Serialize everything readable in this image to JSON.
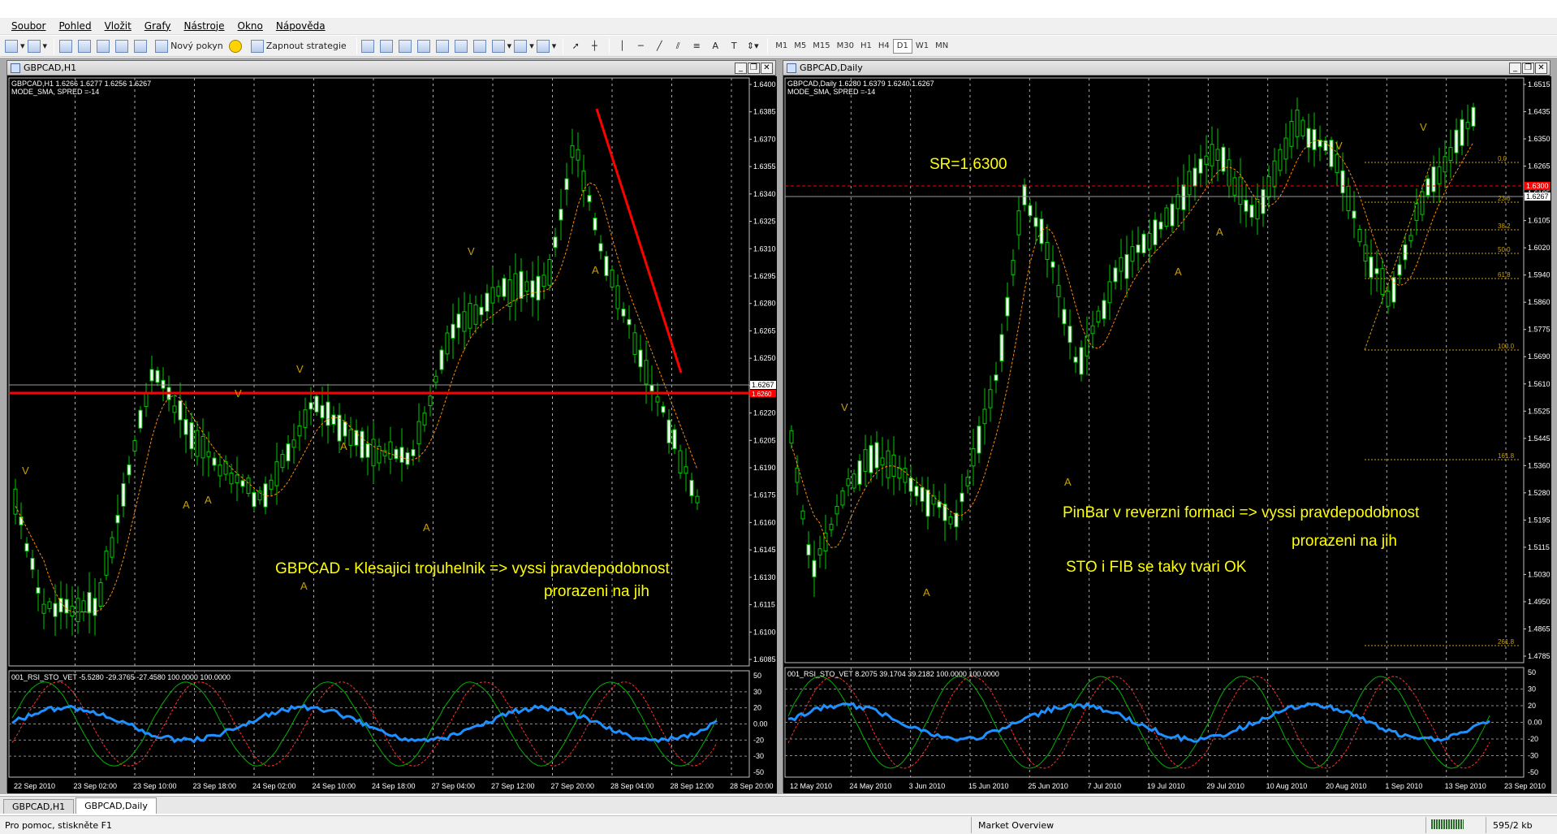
{
  "menu": [
    "Soubor",
    "Pohled",
    "Vložit",
    "Grafy",
    "Nástroje",
    "Okno",
    "Nápověda"
  ],
  "toolbar": {
    "new_order": "Nový pokyn",
    "start_strategy": "Zapnout strategie",
    "timeframes": [
      "M1",
      "M5",
      "M15",
      "M30",
      "H1",
      "H4",
      "D1",
      "W1",
      "MN"
    ],
    "active_timeframe": "D1",
    "icons": [
      "new-chart-icon",
      "profiles-icon",
      "market-watch-icon",
      "navigator-icon",
      "terminal-icon",
      "tester-icon",
      "new-order-icon",
      "expert-warning-icon",
      "start-strategy-icon",
      "bar-chart-icon",
      "candles-icon",
      "line-chart-icon",
      "zoom-in-icon",
      "zoom-out-icon",
      "autoscroll-icon",
      "chart-shift-icon",
      "indicators-icon",
      "periods-icon",
      "templates-icon",
      "cursor-icon",
      "crosshair-icon",
      "vertical-line-icon",
      "horizontal-line-icon",
      "trendline-icon",
      "equidistant-channel-icon",
      "fibonacci-icon",
      "text-icon",
      "text-label-icon",
      "arrows-icon"
    ]
  },
  "window_left": {
    "title": "GBPCAD,H1",
    "info_line1": "GBPCAD,H1  1.6266 1.6277 1.6256 1.6267",
    "info_line2": "MODE_SMA, SPRED =-14",
    "indicator_line": "001_RSI_STO_VET -5.5280 -29.3765 -27.4580 100.0000 100.0000",
    "price_ticks": [
      "1.6400",
      "1.6385",
      "1.6370",
      "1.6355",
      "1.6340",
      "1.6325",
      "1.6310",
      "1.6295",
      "1.6280",
      "1.6265",
      "1.6250",
      "1.6235",
      "1.6220",
      "1.6205",
      "1.6190",
      "1.6175",
      "1.6160",
      "1.6145",
      "1.6130",
      "1.6115",
      "1.6100",
      "1.6085"
    ],
    "current_price": "1.6267",
    "sr_price": "1.6260",
    "ind_ticks": [
      "50",
      "30",
      "20",
      "0.00",
      "-20",
      "-30",
      "-50"
    ],
    "time_labels": [
      "22 Sep 2010",
      "23 Sep 02:00",
      "23 Sep 10:00",
      "23 Sep 18:00",
      "24 Sep 02:00",
      "24 Sep 10:00",
      "24 Sep 18:00",
      "27 Sep 04:00",
      "27 Sep 12:00",
      "27 Sep 20:00",
      "28 Sep 04:00",
      "28 Sep 12:00",
      "28 Sep 20:00"
    ],
    "annotation_line1": "GBPCAD - Klesajici trojuhelnik => vyssi pravdepodobnost",
    "annotation_line2": "prorazeni na jih",
    "fractal_up": "V",
    "fractal_down": "A"
  },
  "window_right": {
    "title": "GBPCAD,Daily",
    "info_line1": "GBPCAD,Daily  1.6280 1.6379 1.6240 1.6267",
    "info_line2": "MODE_SMA, SPRED =-14",
    "indicator_line": "001_RSI_STO_VET 8.2075 39.1704 39.2182 100.0000 100.0000",
    "price_ticks": [
      "1.6515",
      "1.6435",
      "1.6350",
      "1.6265",
      "1.6185",
      "1.6105",
      "1.6020",
      "1.5940",
      "1.5860",
      "1.5775",
      "1.5690",
      "1.5610",
      "1.5525",
      "1.5445",
      "1.5360",
      "1.5280",
      "1.5195",
      "1.5115",
      "1.5030",
      "1.4950",
      "1.4865",
      "1.4785"
    ],
    "current_price": "1.6267",
    "sr_price": "1.6300",
    "fib_levels": [
      "0.0",
      "23.6",
      "38.2",
      "50.0",
      "61.8",
      "100.0",
      "161.8",
      "261.8"
    ],
    "ind_ticks": [
      "50",
      "30",
      "20",
      "0.00",
      "-20",
      "-30",
      "-50"
    ],
    "time_labels": [
      "12 May 2010",
      "24 May 2010",
      "3 Jun 2010",
      "15 Jun 2010",
      "25 Jun 2010",
      "7 Jul 2010",
      "19 Jul 2010",
      "29 Jul 2010",
      "10 Aug 2010",
      "20 Aug 2010",
      "1 Sep 2010",
      "13 Sep 2010",
      "23 Sep 2010"
    ],
    "sr_label": "SR=1,6300",
    "annotation_line1": "PinBar v reverzni formaci => vyssi pravdepodobnost",
    "annotation_line2": "prorazeni na jih",
    "annotation_line3": "STO i FIB se taky tvari OK",
    "fractal_up": "V",
    "fractal_down": "A"
  },
  "tabs": [
    "GBPCAD,H1",
    "GBPCAD,Daily"
  ],
  "active_tab": "GBPCAD,Daily",
  "status": {
    "help": "Pro pomoc, stiskněte F1",
    "profile": "Market Overview",
    "traffic": "595/2 kb"
  },
  "colors": {
    "candle": "#00c800",
    "ma": "#ff8c00",
    "sr_line": "#ff0000",
    "annotation": "#ffff00",
    "fractal": "#c8a000",
    "rsi": "#1e90ff",
    "sto_main": "#00b400",
    "sto_signal": "#ff3030",
    "fib": "#c8a000"
  }
}
